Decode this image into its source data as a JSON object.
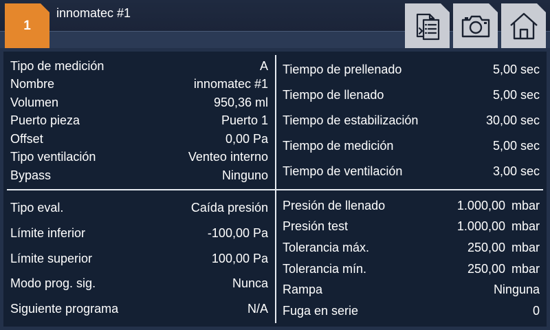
{
  "header": {
    "program_number": "1",
    "program_name": "innomatec #1",
    "buttons": [
      {
        "icon": "document-list-icon"
      },
      {
        "icon": "camera-icon"
      },
      {
        "icon": "home-icon"
      }
    ]
  },
  "params_top_left": [
    {
      "label": "Tipo de medición",
      "value": "A"
    },
    {
      "label": "Nombre",
      "value": "innomatec #1"
    },
    {
      "label": "Volumen",
      "value": "950,36 ml"
    },
    {
      "label": "Puerto pieza",
      "value": "Puerto 1"
    },
    {
      "label": "Offset",
      "value": "0,00 Pa"
    },
    {
      "label": "Tipo ventilación",
      "value": "Venteo interno"
    },
    {
      "label": "Bypass",
      "value": "Ninguno"
    }
  ],
  "params_top_right": [
    {
      "label": "Tiempo de prellenado",
      "value": "5,00 sec"
    },
    {
      "label": "Tiempo de llenado",
      "value": "5,00 sec"
    },
    {
      "label": "Tiempo de estabilización",
      "value": "30,00 sec"
    },
    {
      "label": "Tiempo de medición",
      "value": "5,00 sec"
    },
    {
      "label": "Tiempo de ventilación",
      "value": "3,00 sec"
    }
  ],
  "params_bottom_left": [
    {
      "label": "Tipo eval.",
      "value": "Caída presión"
    },
    {
      "label": "Límite inferior",
      "value": "-100,00 Pa"
    },
    {
      "label": "Límite superior",
      "value": "100,00 Pa"
    },
    {
      "label": "Modo prog. sig.",
      "value": "Nunca"
    },
    {
      "label": "Siguiente programa",
      "value": "N/A"
    }
  ],
  "params_bottom_right": [
    {
      "label": "Presión de llenado",
      "value": "1.000,00",
      "unit": "mbar"
    },
    {
      "label": "Presión test",
      "value": "1.000,00",
      "unit": "mbar"
    },
    {
      "label": "Tolerancia máx.",
      "value": "250,00",
      "unit": "mbar"
    },
    {
      "label": "Tolerancia mín.",
      "value": "250,00",
      "unit": "mbar"
    },
    {
      "label": "Rampa",
      "value": "Ninguna",
      "unit": ""
    },
    {
      "label": "Fuga en serie",
      "value": "0",
      "unit": ""
    }
  ],
  "colors": {
    "accent": "#e5872c",
    "background": "#23314a",
    "panel": "#142033",
    "button": "#c9ccd3"
  }
}
